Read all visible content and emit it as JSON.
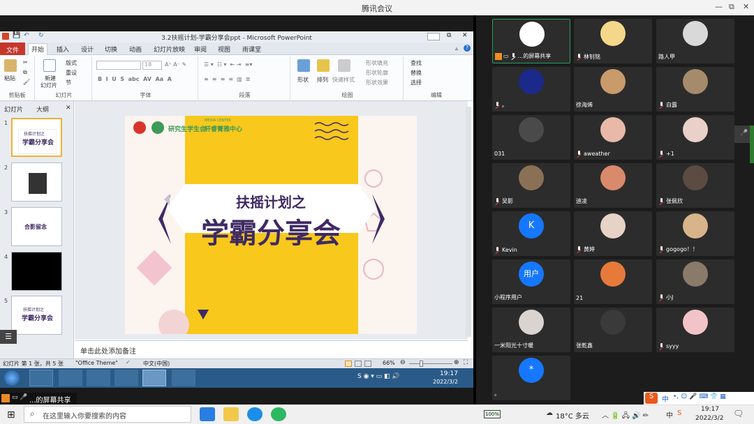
{
  "meeting": {
    "title": "腾讯会议",
    "win_min": "—",
    "win_restore": "⧉",
    "win_close": "✕"
  },
  "ppt": {
    "title": "3.2扶摇计划-学霸分享会ppt - Microsoft PowerPoint",
    "tabs": [
      "文件",
      "开始",
      "插入",
      "设计",
      "切换",
      "动画",
      "幻灯片放映",
      "审阅",
      "视图",
      "雨课堂"
    ],
    "ribbon": {
      "clipboard": {
        "paste": "粘贴",
        "label": "剪贴板"
      },
      "slides": {
        "new_slide": "新建",
        "new_slide2": "幻灯片",
        "layout": "版式",
        "reset": "重设",
        "section": "节",
        "label": "幻灯片"
      },
      "font": {
        "size": "18",
        "label": "字体"
      },
      "paragraph": {
        "label": "段落"
      },
      "drawing": {
        "shape": "形状",
        "arrange": "排列",
        "quick_style": "快速样式",
        "fill": "形状填充",
        "outline": "形状轮廓",
        "effect": "形状效果",
        "label": "绘图"
      },
      "editing": {
        "find": "查找",
        "replace": "替换",
        "select": "选择",
        "label": "编辑"
      }
    },
    "side_tabs": [
      "幻灯片",
      "大纲"
    ],
    "thumbs": [
      {
        "num": "1",
        "line1": "扶摇计划之",
        "line2": "学霸分享会"
      },
      {
        "num": "2",
        "line1": "",
        "line2": ""
      },
      {
        "num": "3",
        "line1": "",
        "line2": "合影留念"
      },
      {
        "num": "4",
        "line1": "",
        "line2": ""
      },
      {
        "num": "5",
        "line1": "扶摇计划之",
        "line2": "学霸分享会"
      }
    ],
    "slide": {
      "logo1": "研究生学生会",
      "logo2": "轩睿菁雅中心",
      "logo2_sub": "MEDIA CENTER",
      "title_small": "扶摇计划之",
      "title_big": "学霸分享会"
    },
    "notes_placeholder": "单击此处添加备注",
    "status": {
      "slide_info": "幻灯片 第 1 张，共 5 张",
      "theme": "\"Office Theme\"",
      "lang": "中文(中国)",
      "zoom": "66%"
    },
    "win7": {
      "time": "19:17",
      "date": "2022/3/2"
    }
  },
  "share_label": "...的屏幕共享",
  "participants": [
    {
      "name": "...的屏幕共享",
      "avatar_color": "#ffffff",
      "active": true,
      "mic": "green",
      "sharing": true
    },
    {
      "name": "林钊铭",
      "avatar_color": "#f5d78a",
      "mic": "red"
    },
    {
      "name": "路人甲",
      "avatar_color": "#d9d9d9",
      "mic": "none"
    },
    {
      "name": "。",
      "avatar_color": "#1b2a8a",
      "mic": "red"
    },
    {
      "name": "徐海烯",
      "avatar_color": "#c99a6a",
      "mic": "none"
    },
    {
      "name": "白露",
      "avatar_color": "#a58b6c",
      "mic": "red"
    },
    {
      "name": "031",
      "avatar_color": "#4a4a4a",
      "mic": "none"
    },
    {
      "name": "aweather",
      "avatar_color": "#e8b9a8",
      "mic": "red"
    },
    {
      "name": "+1",
      "avatar_color": "#e9d0c8",
      "mic": "red"
    },
    {
      "name": "吴影",
      "avatar_color": "#8a7155",
      "mic": "red"
    },
    {
      "name": "迪凌",
      "avatar_color": "#d98a6b",
      "mic": "none"
    },
    {
      "name": "张佩欣",
      "avatar_color": "#5b4b43",
      "mic": "red"
    },
    {
      "name": "Kevin",
      "avatar_color": "#1677ff",
      "letter": "K",
      "mic": "red"
    },
    {
      "name": "黄婷",
      "avatar_color": "#e6d2c6",
      "mic": "red"
    },
    {
      "name": "gogogo！！",
      "avatar_color": "#d8b48a",
      "mic": "red"
    },
    {
      "name": "小程序用户",
      "avatar_color": "#1677ff",
      "letter": "用户",
      "mic": "none"
    },
    {
      "name": "21",
      "avatar_color": "#e57a3a",
      "mic": "none"
    },
    {
      "name": "小J",
      "avatar_color": "#8a7a6a",
      "mic": "red"
    },
    {
      "name": "一米阳光十寸暖",
      "avatar_color": "#d9d4cf",
      "mic": "none"
    },
    {
      "name": "张乾鑫",
      "avatar_color": "#3a3a3a",
      "mic": "none"
    },
    {
      "name": "syyy",
      "avatar_color": "#f2c4c9",
      "mic": "red"
    },
    {
      "name": "。",
      "avatar_color": "#1677ff",
      "letter": "*",
      "mic": "none"
    }
  ],
  "taskbar": {
    "search_placeholder": "在这里输入你要搜索的内容",
    "battery": "100%",
    "weather": "18°C 多云",
    "time": "19:17",
    "date": "2022/3/2",
    "ime": "中",
    "ime2": "中"
  }
}
